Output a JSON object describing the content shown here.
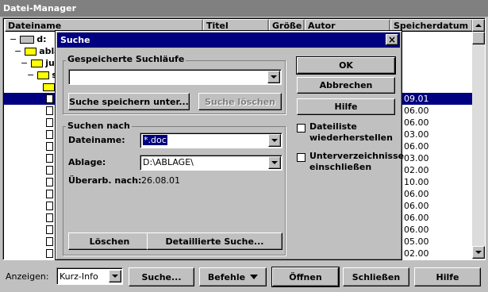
{
  "main": {
    "title": "Datei-Manager",
    "columns": [
      "Dateiname",
      "Titel",
      "Größe",
      "Autor",
      "Speicherdatum"
    ],
    "tree": [
      "d:",
      "abla",
      "ju",
      "s"
    ],
    "dates": [
      "09.01",
      "06.00",
      "06.00",
      "03.00",
      "06.00",
      "03.00",
      "02.00",
      "10.00",
      "06.00",
      "06.00",
      "06.00",
      "06.00",
      "05.00",
      "02.00"
    ],
    "bottom": {
      "anzeigen_label": "Anzeigen:",
      "anzeigen_value": "Kurz-Info",
      "suche": "Suche...",
      "befehle": "Befehle",
      "oeffnen": "Öffnen",
      "schliessen": "Schließen",
      "hilfe": "Hilfe"
    }
  },
  "dialog": {
    "title": "Suche",
    "saved_group": "Gespeicherte Suchläufe",
    "saved_value": "",
    "save_search": "Suche speichern unter...",
    "delete_search": "Suche löschen",
    "search_group": "Suchen nach",
    "filename_label": "Dateiname:",
    "filename_value": "*.doc",
    "location_label": "Ablage:",
    "location_value": "D:\\ABLAGE\\",
    "modified_label": "Überarb. nach:",
    "modified_value": "26.08.01",
    "clear": "Löschen",
    "advanced": "Detaillierte Suche...",
    "ok": "OK",
    "cancel": "Abbrechen",
    "help": "Hilfe",
    "restore_list_1": "Dateiliste",
    "restore_list_2": "wiederherstellen",
    "include_sub_1": "Unterverzeichnisse",
    "include_sub_2": "einschließen"
  }
}
